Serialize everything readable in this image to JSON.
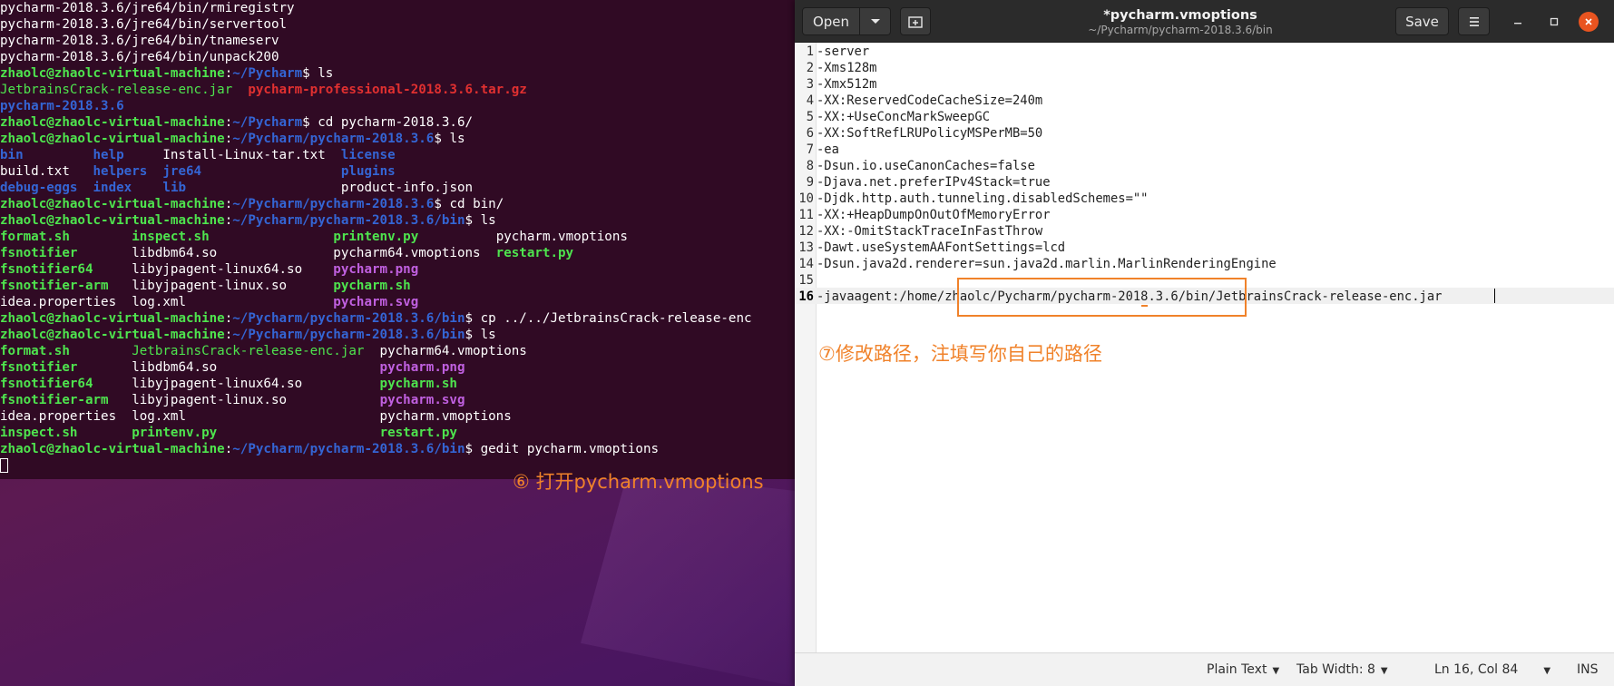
{
  "terminal": {
    "lines": [
      [
        {
          "t": "pycharm-2018.3.6/jre64/bin/rmiregistry",
          "c": "c-white"
        }
      ],
      [
        {
          "t": "pycharm-2018.3.6/jre64/bin/servertool",
          "c": "c-white"
        }
      ],
      [
        {
          "t": "pycharm-2018.3.6/jre64/bin/tnameserv",
          "c": "c-white"
        }
      ],
      [
        {
          "t": "pycharm-2018.3.6/jre64/bin/unpack200",
          "c": "c-white"
        }
      ],
      [
        {
          "t": "zhaolc@zhaolc-virtual-machine",
          "c": "c-green"
        },
        {
          "t": ":",
          "c": "c-white"
        },
        {
          "t": "~/Pycharm",
          "c": "c-blue"
        },
        {
          "t": "$ ls",
          "c": "c-white"
        }
      ],
      [
        {
          "t": "JetbrainsCrack-release-enc.jar",
          "c": "c-green-n"
        },
        {
          "t": "  ",
          "c": "c-white"
        },
        {
          "t": "pycharm-professional-2018.3.6.tar.gz",
          "c": "c-red"
        }
      ],
      [
        {
          "t": "pycharm-2018.3.6",
          "c": "c-blue"
        }
      ],
      [
        {
          "t": "zhaolc@zhaolc-virtual-machine",
          "c": "c-green"
        },
        {
          "t": ":",
          "c": "c-white"
        },
        {
          "t": "~/Pycharm",
          "c": "c-blue"
        },
        {
          "t": "$ cd pycharm-2018.3.6/",
          "c": "c-white"
        }
      ],
      [
        {
          "t": "zhaolc@zhaolc-virtual-machine",
          "c": "c-green"
        },
        {
          "t": ":",
          "c": "c-white"
        },
        {
          "t": "~/Pycharm/pycharm-2018.3.6",
          "c": "c-blue"
        },
        {
          "t": "$ ls",
          "c": "c-white"
        }
      ],
      [
        {
          "t": "bin",
          "c": "c-blue"
        },
        {
          "t": "         ",
          "c": "c-white"
        },
        {
          "t": "help",
          "c": "c-blue"
        },
        {
          "t": "     Install-Linux-tar.txt  ",
          "c": "c-white"
        },
        {
          "t": "license",
          "c": "c-blue"
        }
      ],
      [
        {
          "t": "build.txt   ",
          "c": "c-white"
        },
        {
          "t": "helpers",
          "c": "c-blue"
        },
        {
          "t": "  ",
          "c": "c-white"
        },
        {
          "t": "jre64",
          "c": "c-blue"
        },
        {
          "t": "                  ",
          "c": "c-white"
        },
        {
          "t": "plugins",
          "c": "c-blue"
        }
      ],
      [
        {
          "t": "debug-eggs",
          "c": "c-blue"
        },
        {
          "t": "  ",
          "c": "c-white"
        },
        {
          "t": "index",
          "c": "c-blue"
        },
        {
          "t": "    ",
          "c": "c-white"
        },
        {
          "t": "lib",
          "c": "c-blue"
        },
        {
          "t": "                    product-info.json",
          "c": "c-white"
        }
      ],
      [
        {
          "t": "zhaolc@zhaolc-virtual-machine",
          "c": "c-green"
        },
        {
          "t": ":",
          "c": "c-white"
        },
        {
          "t": "~/Pycharm/pycharm-2018.3.6",
          "c": "c-blue"
        },
        {
          "t": "$ cd bin/",
          "c": "c-white"
        }
      ],
      [
        {
          "t": "zhaolc@zhaolc-virtual-machine",
          "c": "c-green"
        },
        {
          "t": ":",
          "c": "c-white"
        },
        {
          "t": "~/Pycharm/pycharm-2018.3.6/bin",
          "c": "c-blue"
        },
        {
          "t": "$ ls",
          "c": "c-white"
        }
      ],
      [
        {
          "t": "format.sh",
          "c": "c-green"
        },
        {
          "t": "        ",
          "c": "c-white"
        },
        {
          "t": "inspect.sh",
          "c": "c-green"
        },
        {
          "t": "                ",
          "c": "c-white"
        },
        {
          "t": "printenv.py",
          "c": "c-green"
        },
        {
          "t": "          pycharm.vmoptions",
          "c": "c-white"
        }
      ],
      [
        {
          "t": "fsnotifier",
          "c": "c-green"
        },
        {
          "t": "       libdbm64.so               pycharm64.vmoptions  ",
          "c": "c-white"
        },
        {
          "t": "restart.py",
          "c": "c-green"
        }
      ],
      [
        {
          "t": "fsnotifier64",
          "c": "c-green"
        },
        {
          "t": "     libyjpagent-linux64.so    ",
          "c": "c-white"
        },
        {
          "t": "pycharm.png",
          "c": "c-magenta"
        }
      ],
      [
        {
          "t": "fsnotifier-arm",
          "c": "c-green"
        },
        {
          "t": "   libyjpagent-linux.so      ",
          "c": "c-white"
        },
        {
          "t": "pycharm.sh",
          "c": "c-green"
        }
      ],
      [
        {
          "t": "idea.properties  log.xml                   ",
          "c": "c-white"
        },
        {
          "t": "pycharm.svg",
          "c": "c-magenta"
        }
      ],
      [
        {
          "t": "zhaolc@zhaolc-virtual-machine",
          "c": "c-green"
        },
        {
          "t": ":",
          "c": "c-white"
        },
        {
          "t": "~/Pycharm/pycharm-2018.3.6/bin",
          "c": "c-blue"
        },
        {
          "t": "$ cp ../../JetbrainsCrack-release-enc",
          "c": "c-white"
        }
      ],
      [
        {
          "t": "zhaolc@zhaolc-virtual-machine",
          "c": "c-green"
        },
        {
          "t": ":",
          "c": "c-white"
        },
        {
          "t": "~/Pycharm/pycharm-2018.3.6/bin",
          "c": "c-blue"
        },
        {
          "t": "$ ls",
          "c": "c-white"
        }
      ],
      [
        {
          "t": "format.sh",
          "c": "c-green"
        },
        {
          "t": "        ",
          "c": "c-white"
        },
        {
          "t": "JetbrainsCrack-release-enc.jar",
          "c": "c-green-n"
        },
        {
          "t": "  pycharm64.vmoptions",
          "c": "c-white"
        }
      ],
      [
        {
          "t": "fsnotifier",
          "c": "c-green"
        },
        {
          "t": "       libdbm64.so                     ",
          "c": "c-white"
        },
        {
          "t": "pycharm.png",
          "c": "c-magenta"
        }
      ],
      [
        {
          "t": "fsnotifier64",
          "c": "c-green"
        },
        {
          "t": "     libyjpagent-linux64.so          ",
          "c": "c-white"
        },
        {
          "t": "pycharm.sh",
          "c": "c-green"
        }
      ],
      [
        {
          "t": "fsnotifier-arm",
          "c": "c-green"
        },
        {
          "t": "   libyjpagent-linux.so            ",
          "c": "c-white"
        },
        {
          "t": "pycharm.svg",
          "c": "c-magenta"
        }
      ],
      [
        {
          "t": "idea.properties  log.xml                         pycharm.vmoptions",
          "c": "c-white"
        }
      ],
      [
        {
          "t": "inspect.sh",
          "c": "c-green"
        },
        {
          "t": "       ",
          "c": "c-white"
        },
        {
          "t": "printenv.py",
          "c": "c-green"
        },
        {
          "t": "                     ",
          "c": "c-white"
        },
        {
          "t": "restart.py",
          "c": "c-green"
        }
      ],
      [
        {
          "t": "zhaolc@zhaolc-virtual-machine",
          "c": "c-green"
        },
        {
          "t": ":",
          "c": "c-white"
        },
        {
          "t": "~/Pycharm/pycharm-2018.3.6/bin",
          "c": "c-blue"
        },
        {
          "t": "$ gedit pycharm.vmoptions",
          "c": "c-white"
        }
      ]
    ]
  },
  "annotations": {
    "step6": "⑥ 打开pycharm.vmoptions",
    "step7": "⑦修改路径，注填写你自己的路径"
  },
  "gedit": {
    "open_label": "Open",
    "open_arrow_icon": "chevron-down-icon",
    "new_tab_icon": "new-tab-icon",
    "title": "*pycharm.vmoptions",
    "path": "~/Pycharm/pycharm-2018.3.6/bin",
    "save_label": "Save",
    "editor_lines": [
      {
        "n": "1",
        "text": "-server"
      },
      {
        "n": "2",
        "text": "-Xms128m"
      },
      {
        "n": "3",
        "text": "-Xmx512m"
      },
      {
        "n": "4",
        "text": "-XX:ReservedCodeCacheSize=240m"
      },
      {
        "n": "5",
        "text": "-XX:+UseConcMarkSweepGC"
      },
      {
        "n": "6",
        "text": "-XX:SoftRefLRUPolicyMSPerMB=50"
      },
      {
        "n": "7",
        "text": "-ea"
      },
      {
        "n": "8",
        "text": "-Dsun.io.useCanonCaches=false"
      },
      {
        "n": "9",
        "text": "-Djava.net.preferIPv4Stack=true"
      },
      {
        "n": "10",
        "text": "-Djdk.http.auth.tunneling.disabledSchemes=\"\""
      },
      {
        "n": "11",
        "text": "-XX:+HeapDumpOnOutOfMemoryError"
      },
      {
        "n": "12",
        "text": "-XX:-OmitStackTraceInFastThrow"
      },
      {
        "n": "13",
        "text": "-Dawt.useSystemAAFontSettings=lcd"
      },
      {
        "n": "14",
        "text": "-Dsun.java2d.renderer=sun.java2d.marlin.MarlinRenderingEngine"
      },
      {
        "n": "15",
        "text": ""
      },
      {
        "n": "16",
        "text": "-javaagent:/home/zhaolc/Pycharm/pycharm-2018.3.6/bin/JetbrainsCrack-release-enc.jar"
      }
    ],
    "current_line": "16",
    "status": {
      "language": "Plain Text",
      "tab_width": "Tab Width: 8",
      "position": "Ln 16, Col 84",
      "mode": "INS"
    },
    "accent_color": "#e95420",
    "annotation_color": "#f0822a"
  }
}
